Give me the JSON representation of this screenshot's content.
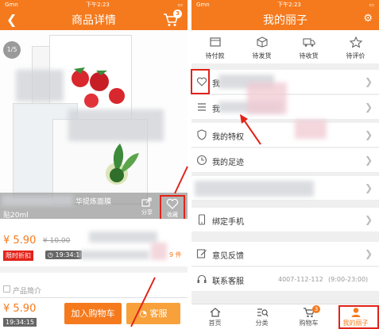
{
  "colors": {
    "brand": "#f57a1d",
    "highlight": "#e2231a"
  },
  "left": {
    "status": {
      "carrier": "Gmn",
      "time": "下午2:23"
    },
    "title": "商品详情",
    "cart_badge": "3",
    "page_indicator": "1/5",
    "product_title_line1": "华提炼面膜",
    "product_title_line2": "贴20ml",
    "share_label": "分享",
    "favorite_label": "收藏",
    "price": "¥ 5.90",
    "old_price": "¥ 10.00",
    "promo_tag": "限时折扣",
    "timer": "19:34:1",
    "sold_count": "9 件",
    "section_label": "产品简介",
    "bottom": {
      "price": "¥ 5.90",
      "timer": "19:34:15",
      "add_cart": "加入购物车",
      "service": "客服"
    }
  },
  "right": {
    "status": {
      "carrier": "Gmn",
      "time": "下午2:23"
    },
    "title": "我的丽子",
    "orders": [
      {
        "label": "待付款",
        "icon": "wallet-icon"
      },
      {
        "label": "待发货",
        "icon": "box-icon"
      },
      {
        "label": "待收货",
        "icon": "truck-icon"
      },
      {
        "label": "待评价",
        "icon": "star-icon"
      }
    ],
    "menu": [
      {
        "label": "我",
        "icon": "heart-icon"
      },
      {
        "label": "我",
        "icon": "list-icon"
      },
      {
        "label": "我的特权",
        "icon": "shield-icon"
      },
      {
        "label": "我的足迹",
        "icon": "clock-icon"
      },
      {
        "label": "",
        "icon": ""
      },
      {
        "label": "绑定手机",
        "icon": "phone-icon"
      },
      {
        "label": "意见反馈",
        "icon": "edit-icon"
      },
      {
        "label": "联系客服",
        "icon": "headset-icon",
        "value": "4007-112-112",
        "hours": "(9:00-23:00)"
      }
    ],
    "tabs": [
      {
        "label": "首页"
      },
      {
        "label": "分类"
      },
      {
        "label": "购物车",
        "badge": "3"
      },
      {
        "label": "我的丽子"
      }
    ]
  }
}
